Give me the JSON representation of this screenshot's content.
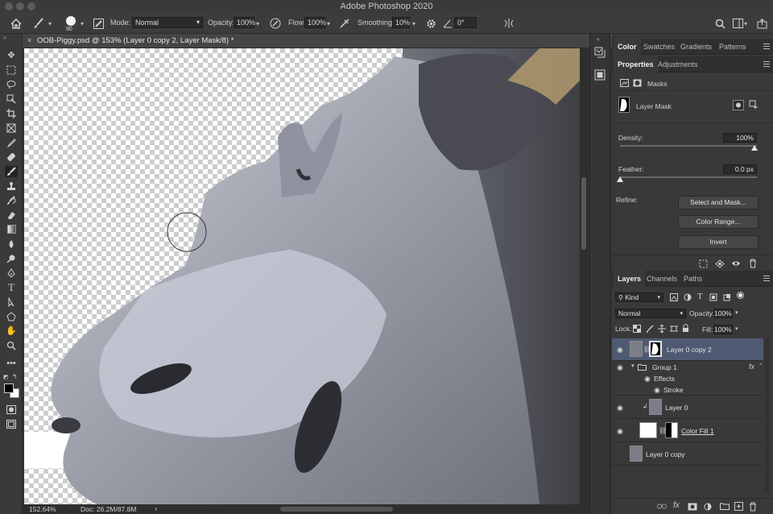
{
  "window": {
    "title": "Adobe Photoshop 2020"
  },
  "options": {
    "brush_size": "90",
    "mode_label": "Mode:",
    "mode_value": "Normal",
    "opacity_label": "Opacity:",
    "opacity_value": "100%",
    "flow_label": "Flow:",
    "flow_value": "100%",
    "smoothing_label": "Smoothing:",
    "smoothing_value": "10%",
    "angle_value": "0°"
  },
  "document": {
    "tab_title": "OOB-Piggy.psd @ 153% (Layer 0 copy 2, Layer Mask/8) *"
  },
  "status": {
    "zoom": "152.64%",
    "doc": "Doc: 26.2M/87.8M"
  },
  "top_panel": {
    "tabs": [
      "Color",
      "Swatches",
      "Gradients",
      "Patterns"
    ],
    "selected": "Color"
  },
  "properties": {
    "tabs": [
      "Properties",
      "Adjustments"
    ],
    "section": "Masks",
    "mask_type": "Layer Mask",
    "density_label": "Density:",
    "density_value": "100%",
    "feather_label": "Feather:",
    "feather_value": "0.0 px",
    "refine_label": "Refine:",
    "buttons": [
      "Select and Mask...",
      "Color Range...",
      "Invert"
    ]
  },
  "layers_panel": {
    "tabs": [
      "Layers",
      "Channels",
      "Paths"
    ],
    "filter_kind": "Kind",
    "blend_mode": "Normal",
    "opacity_label": "Opacity:",
    "opacity_value": "100%",
    "lock_label": "Lock:",
    "fill_label": "Fill:",
    "fill_value": "100%",
    "layers": [
      {
        "name": "Layer 0 copy 2",
        "visible": true,
        "selected": true
      },
      {
        "name": "Group 1",
        "visible": true,
        "fx": "fx"
      },
      {
        "name": "Effects",
        "visible": true
      },
      {
        "name": "Stroke",
        "visible": true
      },
      {
        "name": "Layer 0",
        "visible": true
      },
      {
        "name": "Color Fill 1",
        "visible": true
      },
      {
        "name": "Layer 0 copy",
        "visible": false
      }
    ]
  },
  "colors": {
    "accent_selected": "#4f5a72",
    "foreground": "#000000",
    "background": "#ffffff"
  }
}
